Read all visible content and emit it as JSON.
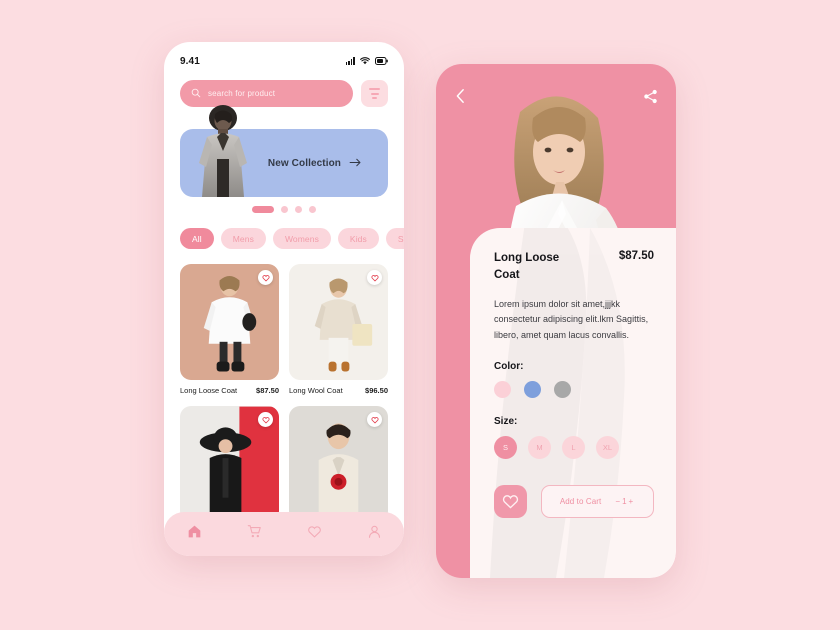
{
  "background_color": "#fcdde1",
  "home_screen": {
    "status_bar": {
      "time": "9.41",
      "icons": [
        "signal-icon",
        "wifi-icon",
        "battery-icon"
      ]
    },
    "search": {
      "placeholder": "search for product",
      "icon": "search-icon"
    },
    "filter": {
      "icon": "filter-icon"
    },
    "banner": {
      "label": "New Collection",
      "arrow": "arrow-right-icon",
      "color": "#a9bdea"
    },
    "carousel": {
      "dots": 4,
      "active_index": 0
    },
    "categories": [
      {
        "label": "All",
        "active": true
      },
      {
        "label": "Mens",
        "active": false
      },
      {
        "label": "Womens",
        "active": false
      },
      {
        "label": "Kids",
        "active": false
      },
      {
        "label": "Sport",
        "active": false
      }
    ],
    "products": [
      {
        "name": "Long Loose Coat",
        "price": "$87.50",
        "bg": "#d9a891",
        "fav": "heart-icon"
      },
      {
        "name": "Long Wool Coat",
        "price": "$96.50",
        "bg": "#f2efea",
        "fav": "heart-icon"
      },
      {
        "name": "",
        "price": "",
        "bg": "#e7e5e2",
        "fav": "heart-icon"
      },
      {
        "name": "",
        "price": "",
        "bg": "#dcd9d4",
        "fav": "heart-icon"
      }
    ],
    "tabbar": [
      {
        "icon": "home-icon",
        "active": true
      },
      {
        "icon": "cart-icon",
        "active": false
      },
      {
        "icon": "heart-icon",
        "active": false
      },
      {
        "icon": "profile-icon",
        "active": false
      }
    ]
  },
  "detail_screen": {
    "back": {
      "icon": "chevron-left-icon"
    },
    "share": {
      "icon": "share-icon"
    },
    "product": {
      "title": "Long Loose Coat",
      "price": "$87.50",
      "description": "Lorem ipsum dolor sit amet,jjjkk consectetur adipiscing elit.lkm Sagittis, libero, amet quam lacus convallis."
    },
    "color": {
      "label": "Color:",
      "options": [
        {
          "name": "pink",
          "hex": "#fbd0d7"
        },
        {
          "name": "blue",
          "hex": "#7e9fdc"
        },
        {
          "name": "gray",
          "hex": "#a8a8a8"
        }
      ]
    },
    "size": {
      "label": "Size:",
      "options": [
        {
          "label": "S",
          "active": true
        },
        {
          "label": "M",
          "active": false
        },
        {
          "label": "L",
          "active": false
        },
        {
          "label": "XL",
          "active": false
        }
      ]
    },
    "favorite": {
      "icon": "heart-icon"
    },
    "cart": {
      "label": "Add to Cart",
      "quantity": "1",
      "minus": "−",
      "plus": "+"
    }
  }
}
